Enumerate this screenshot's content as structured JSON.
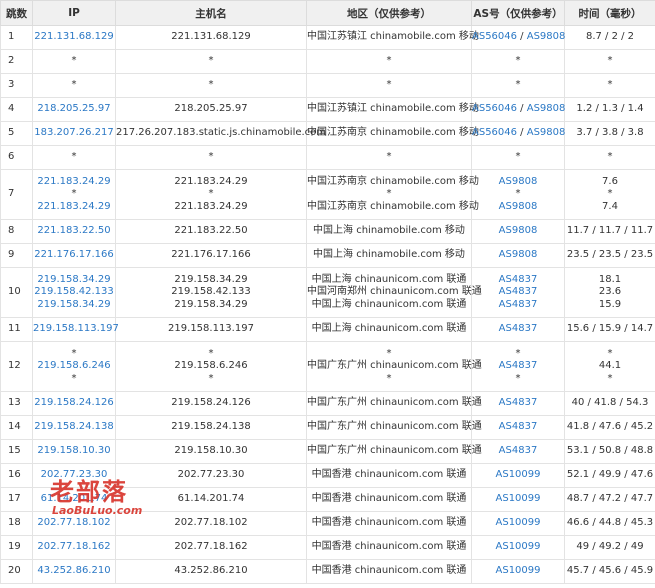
{
  "headers": {
    "hop": "跳数",
    "ip": "IP",
    "host": "主机名",
    "region": "地区（仅供参考）",
    "as": "AS号（仅供参考）",
    "time": "时间（毫秒）"
  },
  "watermark": {
    "cn": "老部落",
    "en": "LaoBuLuo.com"
  },
  "colors": {
    "link": "#2b78c5",
    "header_bg": "#f0f0f0",
    "watermark": "#d8362d"
  },
  "rows": [
    {
      "hop": "1",
      "h": 24,
      "ip": [
        "221.131.68.129"
      ],
      "host": [
        "221.131.68.129"
      ],
      "region": [
        "中国江苏镇江 chinamobile.com 移动"
      ],
      "as": [
        [
          "AS56046",
          "AS9808"
        ]
      ],
      "time": [
        "8.7 / 2 / 2"
      ]
    },
    {
      "hop": "2",
      "h": 24,
      "ip": [
        "*"
      ],
      "host": [
        "*"
      ],
      "region": [
        "*"
      ],
      "as": [
        [
          "*"
        ]
      ],
      "time": [
        "*"
      ]
    },
    {
      "hop": "3",
      "h": 24,
      "ip": [
        "*"
      ],
      "host": [
        "*"
      ],
      "region": [
        "*"
      ],
      "as": [
        [
          "*"
        ]
      ],
      "time": [
        "*"
      ]
    },
    {
      "hop": "4",
      "h": 24,
      "ip": [
        "218.205.25.97"
      ],
      "host": [
        "218.205.25.97"
      ],
      "region": [
        "中国江苏镇江 chinamobile.com 移动"
      ],
      "as": [
        [
          "AS56046",
          "AS9808"
        ]
      ],
      "time": [
        "1.2 / 1.3 / 1.4"
      ]
    },
    {
      "hop": "5",
      "h": 24,
      "ip": [
        "183.207.26.217"
      ],
      "host": [
        "217.26.207.183.static.js.chinamobile.com"
      ],
      "region": [
        "中国江苏南京 chinamobile.com 移动"
      ],
      "as": [
        [
          "AS56046",
          "AS9808"
        ]
      ],
      "time": [
        "3.7 / 3.8 / 3.8"
      ]
    },
    {
      "hop": "6",
      "h": 24,
      "ip": [
        "*"
      ],
      "host": [
        "*"
      ],
      "region": [
        "*"
      ],
      "as": [
        [
          "*"
        ]
      ],
      "time": [
        "*"
      ]
    },
    {
      "hop": "7",
      "h": 50,
      "ip": [
        "221.183.24.29",
        "*",
        "221.183.24.29"
      ],
      "host": [
        "221.183.24.29",
        "*",
        "221.183.24.29"
      ],
      "region": [
        "中国江苏南京 chinamobile.com 移动",
        "*",
        "中国江苏南京 chinamobile.com 移动"
      ],
      "as": [
        [
          "AS9808"
        ],
        [
          "*"
        ],
        [
          "AS9808"
        ]
      ],
      "time": [
        "7.6",
        "*",
        "7.4"
      ]
    },
    {
      "hop": "8",
      "h": 24,
      "ip": [
        "221.183.22.50"
      ],
      "host": [
        "221.183.22.50"
      ],
      "region": [
        "中国上海 chinamobile.com 移动"
      ],
      "as": [
        [
          "AS9808"
        ]
      ],
      "time": [
        "11.7 / 11.7 / 11.7"
      ]
    },
    {
      "hop": "9",
      "h": 24,
      "ip": [
        "221.176.17.166"
      ],
      "host": [
        "221.176.17.166"
      ],
      "region": [
        "中国上海 chinamobile.com 移动"
      ],
      "as": [
        [
          "AS9808"
        ]
      ],
      "time": [
        "23.5 / 23.5 / 23.5"
      ]
    },
    {
      "hop": "10",
      "h": 50,
      "ip": [
        "219.158.34.29",
        "219.158.42.133",
        "219.158.34.29"
      ],
      "host": [
        "219.158.34.29",
        "219.158.42.133",
        "219.158.34.29"
      ],
      "region": [
        "中国上海 chinaunicom.com 联通",
        "中国河南郑州 chinaunicom.com 联通",
        "中国上海 chinaunicom.com 联通"
      ],
      "as": [
        [
          "AS4837"
        ],
        [
          "AS4837"
        ],
        [
          "AS4837"
        ]
      ],
      "time": [
        "18.1",
        "23.6",
        "15.9"
      ]
    },
    {
      "hop": "11",
      "h": 24,
      "ip": [
        "219.158.113.197"
      ],
      "host": [
        "219.158.113.197"
      ],
      "region": [
        "中国上海 chinaunicom.com 联通"
      ],
      "as": [
        [
          "AS4837"
        ]
      ],
      "time": [
        "15.6 / 15.9 / 14.7"
      ]
    },
    {
      "hop": "12",
      "h": 50,
      "ip": [
        "*",
        "219.158.6.246",
        "*"
      ],
      "host": [
        "*",
        "219.158.6.246",
        "*"
      ],
      "region": [
        "*",
        "中国广东广州 chinaunicom.com 联通",
        "*"
      ],
      "as": [
        [
          "*"
        ],
        [
          "AS4837"
        ],
        [
          "*"
        ]
      ],
      "time": [
        "*",
        "44.1",
        "*"
      ]
    },
    {
      "hop": "13",
      "h": 24,
      "ip": [
        "219.158.24.126"
      ],
      "host": [
        "219.158.24.126"
      ],
      "region": [
        "中国广东广州 chinaunicom.com 联通"
      ],
      "as": [
        [
          "AS4837"
        ]
      ],
      "time": [
        "40 / 41.8 / 54.3"
      ]
    },
    {
      "hop": "14",
      "h": 24,
      "ip": [
        "219.158.24.138"
      ],
      "host": [
        "219.158.24.138"
      ],
      "region": [
        "中国广东广州 chinaunicom.com 联通"
      ],
      "as": [
        [
          "AS4837"
        ]
      ],
      "time": [
        "41.8 / 47.6 / 45.2"
      ]
    },
    {
      "hop": "15",
      "h": 24,
      "ip": [
        "219.158.10.30"
      ],
      "host": [
        "219.158.10.30"
      ],
      "region": [
        "中国广东广州 chinaunicom.com 联通"
      ],
      "as": [
        [
          "AS4837"
        ]
      ],
      "time": [
        "53.1 / 50.8 / 48.8"
      ]
    },
    {
      "hop": "16",
      "h": 24,
      "ip": [
        "202.77.23.30"
      ],
      "host": [
        "202.77.23.30"
      ],
      "region": [
        "中国香港 chinaunicom.com 联通"
      ],
      "as": [
        [
          "AS10099"
        ]
      ],
      "time": [
        "52.1 / 49.9 / 47.6"
      ]
    },
    {
      "hop": "17",
      "h": 24,
      "ip": [
        "61.14.201.74"
      ],
      "host": [
        "61.14.201.74"
      ],
      "region": [
        "中国香港 chinaunicom.com 联通"
      ],
      "as": [
        [
          "AS10099"
        ]
      ],
      "time": [
        "48.7 / 47.2 / 47.7"
      ]
    },
    {
      "hop": "18",
      "h": 24,
      "ip": [
        "202.77.18.102"
      ],
      "host": [
        "202.77.18.102"
      ],
      "region": [
        "中国香港 chinaunicom.com 联通"
      ],
      "as": [
        [
          "AS10099"
        ]
      ],
      "time": [
        "46.6 / 44.8 / 45.3"
      ]
    },
    {
      "hop": "19",
      "h": 24,
      "ip": [
        "202.77.18.162"
      ],
      "host": [
        "202.77.18.162"
      ],
      "region": [
        "中国香港 chinaunicom.com 联通"
      ],
      "as": [
        [
          "AS10099"
        ]
      ],
      "time": [
        "49 / 49.2 / 49"
      ]
    },
    {
      "hop": "20",
      "h": 24,
      "ip": [
        "43.252.86.210"
      ],
      "host": [
        "43.252.86.210"
      ],
      "region": [
        "中国香港 chinaunicom.com 联通"
      ],
      "as": [
        [
          "AS10099"
        ]
      ],
      "time": [
        "45.7 / 45.6 / 45.9"
      ]
    }
  ]
}
